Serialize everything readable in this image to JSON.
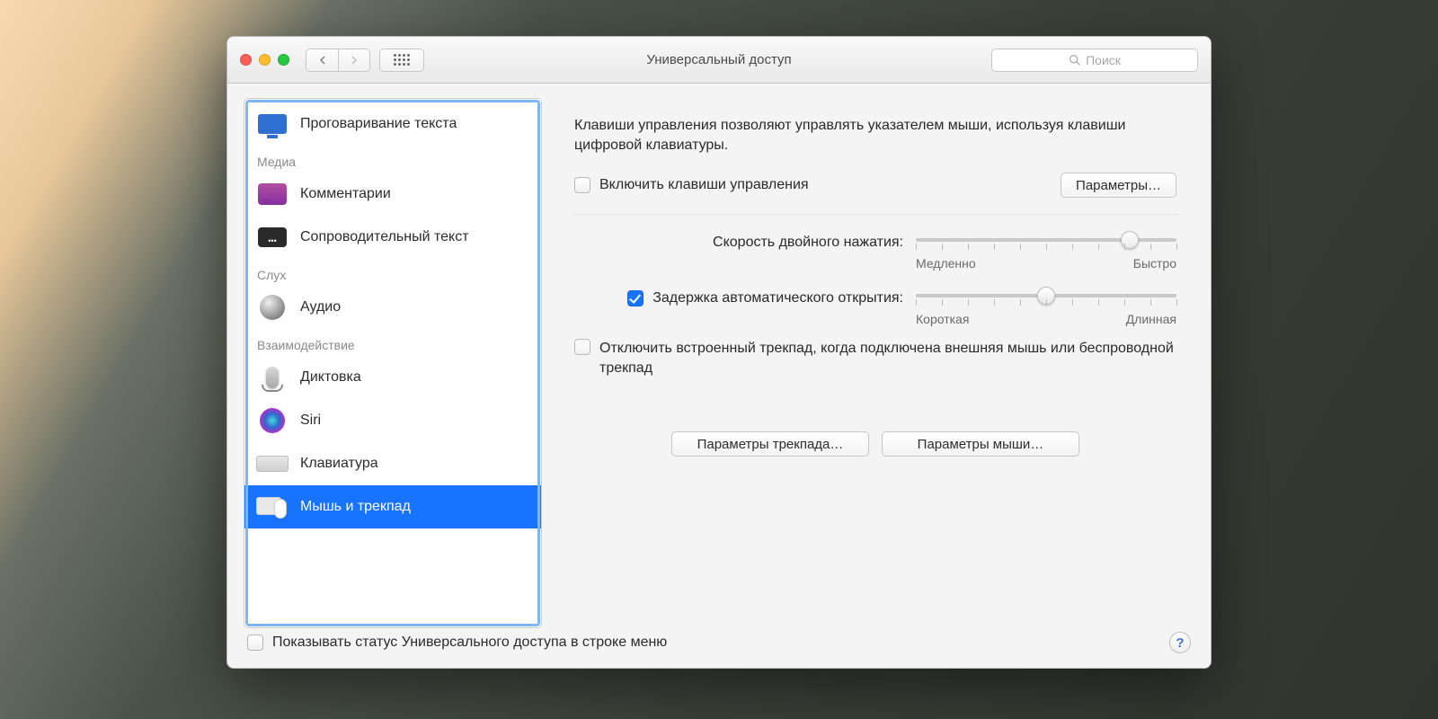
{
  "window": {
    "title": "Универсальный доступ"
  },
  "search": {
    "placeholder": "Поиск"
  },
  "sidebar": {
    "items": [
      {
        "label": "Проговаривание текста"
      }
    ],
    "section_media": "Медиа",
    "media": [
      {
        "label": "Комментарии"
      },
      {
        "label": "Сопроводительный текст"
      }
    ],
    "section_hearing": "Слух",
    "hearing": [
      {
        "label": "Аудио"
      }
    ],
    "section_interact": "Взаимодействие",
    "interact": [
      {
        "label": "Диктовка"
      },
      {
        "label": "Siri"
      },
      {
        "label": "Клавиатура"
      },
      {
        "label": "Мышь и трекпад"
      }
    ]
  },
  "content": {
    "intro": "Клавиши управления позволяют управлять указателем мыши, используя клавиши цифровой клавиатуры.",
    "enable_keys": "Включить клавиши управления",
    "options_btn": "Параметры…",
    "dblclick_label": "Скорость двойного нажатия:",
    "dblclick_min": "Медленно",
    "dblclick_max": "Быстро",
    "dblclick_value": 0.82,
    "springload_label": "Задержка автоматического открытия:",
    "springload_min": "Короткая",
    "springload_max": "Длинная",
    "springload_value": 0.5,
    "springload_checked": true,
    "disable_trackpad": "Отключить встроенный трекпад, когда подключена внешняя мышь или беспроводной трекпад",
    "trackpad_btn": "Параметры трекпада…",
    "mouse_btn": "Параметры мыши…"
  },
  "footer": {
    "show_status": "Показывать статус Универсального доступа в строке меню"
  }
}
